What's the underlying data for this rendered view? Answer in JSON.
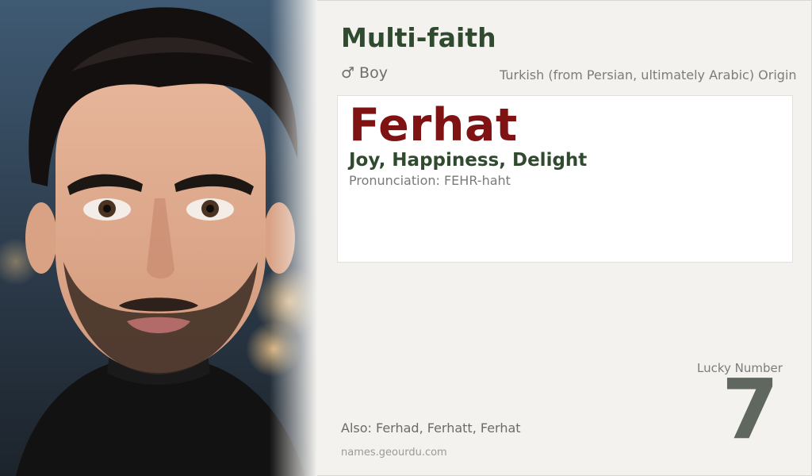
{
  "category": "Multi-faith",
  "gender": {
    "symbol": "♂",
    "label": "Boy"
  },
  "origin": "Turkish (from Persian, ultimately Arabic) Origin",
  "name": "Ferhat",
  "meaning": "Joy, Happiness, Delight",
  "pronunciation": "Pronunciation: FEHR-haht",
  "lucky": {
    "label": "Lucky Number",
    "number": "7"
  },
  "also": "Also: Ferhad, Ferhatt, Ferhat",
  "site": "names.geourdu.com",
  "colors": {
    "category": "#2f4a2f",
    "name": "#7f1313",
    "lucky_number": "#5f675f",
    "background": "#f3f2ef"
  },
  "portrait": {
    "subject": "young man with dark styled hair, beard and black turtleneck"
  }
}
